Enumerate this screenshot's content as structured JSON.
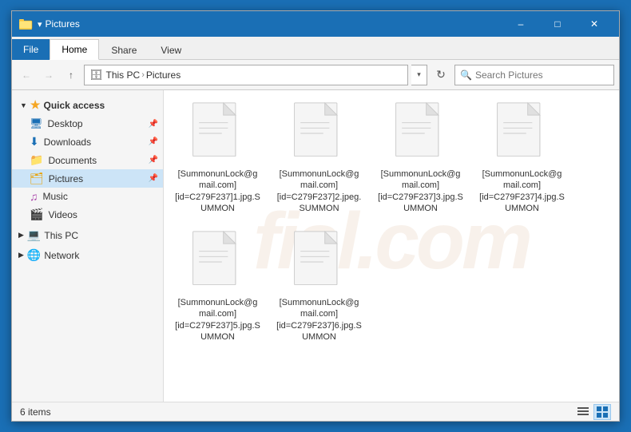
{
  "titlebar": {
    "title": "Pictures",
    "min_label": "–",
    "max_label": "□",
    "close_label": "✕"
  },
  "ribbon": {
    "tabs": [
      "File",
      "Home",
      "Share",
      "View"
    ]
  },
  "addressbar": {
    "path_parts": [
      "This PC",
      "Pictures"
    ],
    "search_placeholder": "Search Pictures"
  },
  "sidebar": {
    "quick_access_label": "Quick access",
    "items": [
      {
        "label": "Desktop",
        "icon": "desktop"
      },
      {
        "label": "Downloads",
        "icon": "download"
      },
      {
        "label": "Documents",
        "icon": "documents"
      },
      {
        "label": "Pictures",
        "icon": "pictures",
        "active": true
      },
      {
        "label": "Music",
        "icon": "music"
      },
      {
        "label": "Videos",
        "icon": "videos"
      }
    ],
    "this_pc_label": "This PC",
    "network_label": "Network"
  },
  "files": [
    {
      "name": "[SummonunLock@gmail.com][id=C279F237]1.jpg.SUMMON",
      "type": "document"
    },
    {
      "name": "[SummonunLock@gmail.com][id=C279F237]2.jpeg.SUMMON",
      "type": "document"
    },
    {
      "name": "[SummonunLock@gmail.com][id=C279F237]3.jpg.SUMMON",
      "type": "document"
    },
    {
      "name": "[SummonunLock@gmail.com][id=C279F237]4.jpg.SUMMON",
      "type": "document"
    },
    {
      "name": "[SummonunLock@gmail.com][id=C279F237]5.jpg.SUMMON",
      "type": "document"
    },
    {
      "name": "[SummonunLock@gmail.com][id=C279F237]6.jpg.SUMMON",
      "type": "document"
    }
  ],
  "statusbar": {
    "item_count": "6 items"
  }
}
